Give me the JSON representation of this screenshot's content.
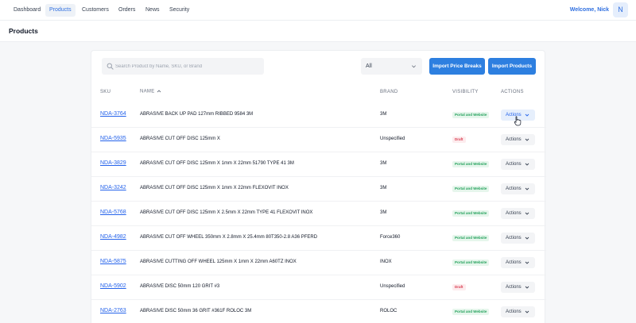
{
  "nav": {
    "items": [
      {
        "label": "Dashboard",
        "active": false
      },
      {
        "label": "Products",
        "active": true
      },
      {
        "label": "Customers",
        "active": false
      },
      {
        "label": "Orders",
        "active": false
      },
      {
        "label": "News",
        "active": false
      },
      {
        "label": "Security",
        "active": false
      }
    ],
    "welcome": "Welcome, Nick",
    "avatar_initial": "N"
  },
  "page": {
    "title": "Products"
  },
  "toolbar": {
    "search_placeholder": "Search Product by Name, SKU, or Brand",
    "search_value": "",
    "filter_value": "All",
    "import_price_breaks_label": "Import Price Breaks",
    "import_products_label": "Import Products"
  },
  "table": {
    "columns": {
      "sku": "SKU",
      "name": "NAME",
      "brand": "BRAND",
      "visibility": "VISIBILITY",
      "actions": "ACTIONS"
    },
    "sort": {
      "column": "NAME",
      "direction": "ascending"
    },
    "rows": [
      {
        "sku": "NDA-3764",
        "name": "ABRASIVE BACK UP PAD 127mm RIBBED 9584 3M",
        "brand": "3M",
        "visibility": "Portal and Website",
        "action_label": "Actions"
      },
      {
        "sku": "NDA-5935",
        "name": "ABRASIVE CUT OFF DISC 125mm X",
        "brand": "Unspecified",
        "visibility": "Draft",
        "action_label": "Actions"
      },
      {
        "sku": "NDA-3829",
        "name": "ABRASIVE CUT OFF DISC 125mm X 1mm X 22mm 51790 TYPE 41 3M",
        "brand": "3M",
        "visibility": "Portal and Website",
        "action_label": "Actions"
      },
      {
        "sku": "NDA-3242",
        "name": "ABRASIVE CUT OFF DISC 125mm X 1mm X 22mm FLEXOVIT INOX",
        "brand": "3M",
        "visibility": "Portal and Website",
        "action_label": "Actions"
      },
      {
        "sku": "NDA-5768",
        "name": "ABRASIVE CUT OFF DISC 125mm X 2.5mm X 22mm TYPE 41 FLEXOVIT INOX",
        "brand": "3M",
        "visibility": "Portal and Website",
        "action_label": "Actions"
      },
      {
        "sku": "NDA-4982",
        "name": "ABRASIVE CUT OFF WHEEL 350mm X 2.8mm X 25.4mm 80T350-2.8 A36 PFERD",
        "brand": "Force360",
        "visibility": "Portal and Website",
        "action_label": "Actions"
      },
      {
        "sku": "NDA-5875",
        "name": "ABRASIVE CUTTING OFF WHEEL 125mm X 1mm X 22mm A60TZ INOX",
        "brand": "INOX",
        "visibility": "Portal and Website",
        "action_label": "Actions"
      },
      {
        "sku": "NDA-5902",
        "name": "ABRASIVE DISC 50mm 120 GRIT #3",
        "brand": "Unspecified",
        "visibility": "Draft",
        "action_label": "Actions"
      },
      {
        "sku": "NDA-2763",
        "name": "ABRASIVE DISC 50mm 36 GRIT #361F ROLOC 3M",
        "brand": "ROLOC",
        "visibility": "Portal and Website",
        "action_label": "Actions"
      }
    ]
  },
  "colors": {
    "accent": "#2d7fe0",
    "link": "#2563eb",
    "portal_badge": "#22a05a",
    "draft_badge": "#d8394c"
  }
}
